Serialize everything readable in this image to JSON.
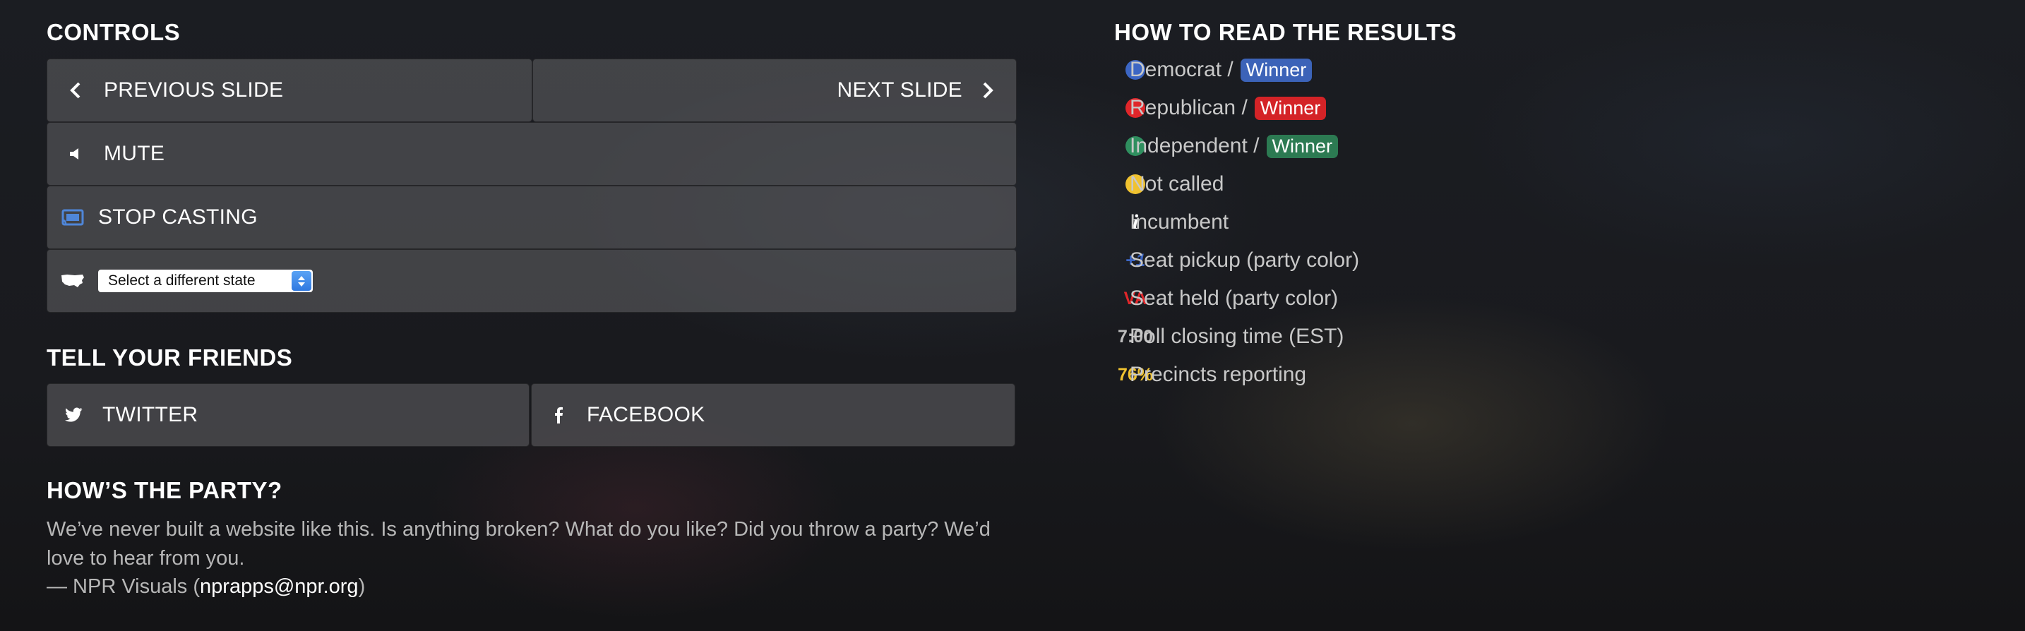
{
  "controls": {
    "heading": "CONTROLS",
    "previous_label": "PREVIOUS SLIDE",
    "next_label": "NEXT SLIDE",
    "mute_label": "MUTE",
    "cast_label": "STOP CASTING",
    "state_select": {
      "selected": "Select a different state"
    }
  },
  "share": {
    "heading": "TELL YOUR FRIENDS",
    "twitter_label": "TWITTER",
    "facebook_label": "FACEBOOK"
  },
  "party": {
    "heading": "HOW’S THE PARTY?",
    "body": "We’ve never built a website like this. Is anything broken? What do you like? Did you throw a party? We’d love to hear from you.",
    "credit_prefix": "— NPR Visuals (",
    "email": "nprapps@npr.org",
    "credit_suffix": ")"
  },
  "legend": {
    "heading": "HOW TO READ THE RESULTS",
    "winner_badge": "Winner",
    "items": [
      {
        "label": "Democrat / ",
        "color": "#3c66c4",
        "badge_color": "#3c63b8"
      },
      {
        "label": "Republican / ",
        "color": "#e0262a",
        "badge_color": "#d42327"
      },
      {
        "label": "Independent / ",
        "color": "#2f8f5f",
        "badge_color": "#2c7a52"
      },
      {
        "label": "Not called",
        "color": "#f0c230"
      },
      {
        "label": "Incumbent",
        "symbol": "i"
      },
      {
        "label": "Seat pickup (party color)",
        "symbol": "+1",
        "symbol_color": "#3c66c4"
      },
      {
        "label": "Seat held (party color)",
        "symbol": "VA",
        "symbol_color": "#e0262a"
      },
      {
        "label": "Poll closing time (EST)",
        "symbol": "7:00",
        "symbol_color": "#bdbdbd"
      },
      {
        "label": "Precincts reporting",
        "symbol": "76%",
        "symbol_color": "#f0c230"
      }
    ]
  },
  "icons": [
    "chevron-left-icon",
    "chevron-right-icon",
    "speaker-icon",
    "cast-icon",
    "usa-map-icon",
    "twitter-icon",
    "facebook-icon"
  ]
}
